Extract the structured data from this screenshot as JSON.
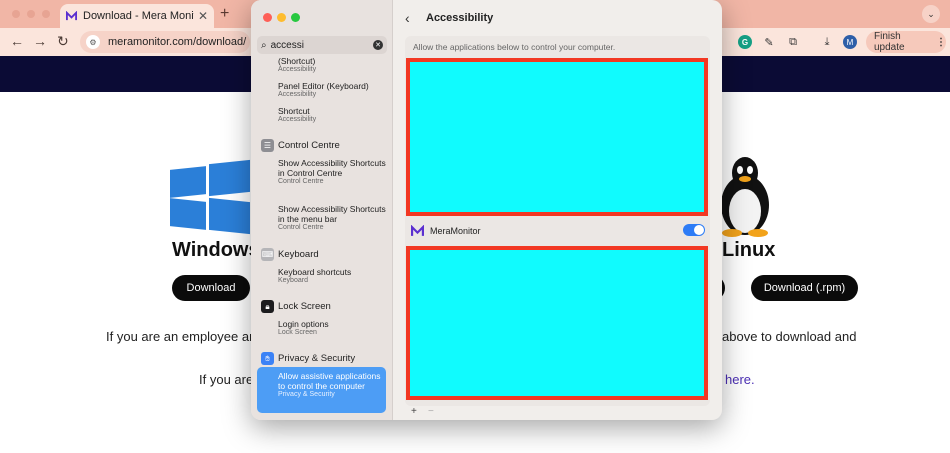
{
  "browser": {
    "tab_title": "Download - Mera Monitor",
    "tab_close": "✕",
    "new_tab": "+",
    "address": "meramonitor.com/download/",
    "finish_update": "Finish update",
    "finish_update_more": "⋮",
    "profile_initial": "M",
    "grammarly_initial": "G"
  },
  "page": {
    "windows_title": "Windows",
    "linux_title": "Linux",
    "download_windows": "Download",
    "download_rpm": "Download (.rpm)",
    "line1_left": "If you are an employee and",
    "line1_right": "above to download and",
    "line2_left": "If you are",
    "line2_link": "here."
  },
  "settings": {
    "search_value": "accessi",
    "results": [
      {
        "title": "(Shortcut)",
        "sub": "Accessibility"
      },
      {
        "title": "Panel Editor (Keyboard)",
        "sub": "Accessibility"
      },
      {
        "title": "Shortcut",
        "sub": "Accessibility"
      },
      {
        "title": "Show Accessibility Shortcuts in Control Centre",
        "sub": "Control Centre"
      },
      {
        "title": "Show Accessibility Shortcuts in the menu bar",
        "sub": "Control Centre"
      },
      {
        "title": "Keyboard shortcuts",
        "sub": "Keyboard"
      },
      {
        "title": "Login options",
        "sub": "Lock Screen"
      }
    ],
    "sections": {
      "control_centre": "Control Centre",
      "keyboard": "Keyboard",
      "lock_screen": "Lock Screen",
      "privacy": "Privacy & Security"
    },
    "selected": {
      "title": "Allow assistive applications to control the computer",
      "sub": "Privacy & Security"
    },
    "pane_title": "Accessibility",
    "pane_description": "Allow the applications below to control your computer.",
    "app_name": "MeraMonitor",
    "app_enabled": true,
    "add_label": "+",
    "remove_label": "−"
  },
  "colors": {
    "tab_bar": "#f1b6a6",
    "toolbar": "#fbe5dc",
    "site_header": "#0b0b35",
    "selected_item": "#4d9df5",
    "redaction_fill": "#10fbfe",
    "redaction_border": "#f23722",
    "toggle_on": "#2d7cf6"
  }
}
